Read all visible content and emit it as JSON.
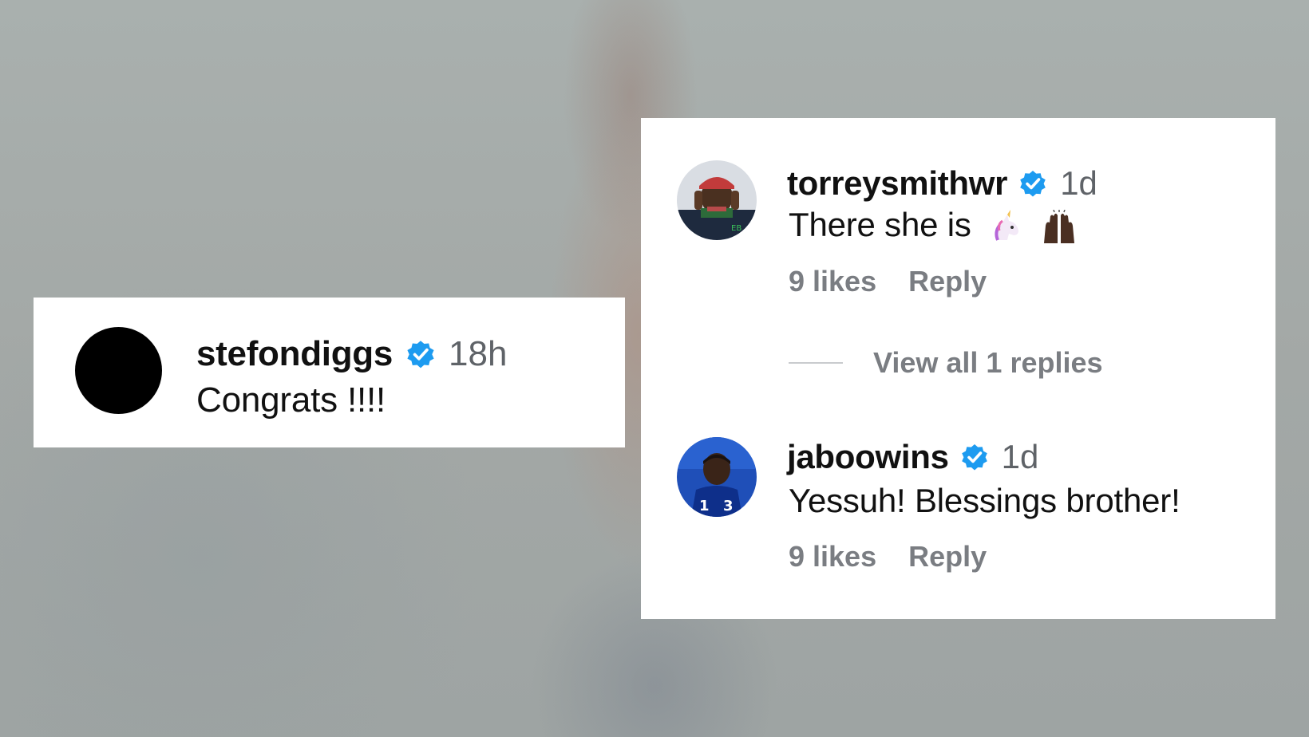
{
  "comments": {
    "stefondiggs": {
      "username": "stefondiggs",
      "time": "18h",
      "text": "Congrats !!!!",
      "verified_icon": "verified-badge-icon"
    },
    "torreysmithwr": {
      "username": "torreysmithwr",
      "time": "1d",
      "text": "There she is",
      "emojis": [
        "unicorn-icon",
        "raised-hands-icon"
      ],
      "likes": "9 likes",
      "reply": "Reply",
      "view_replies": "View all 1 replies"
    },
    "jaboowins": {
      "username": "jaboowins",
      "time": "1d",
      "text": "Yessuh! Blessings brother!",
      "likes": "9 likes",
      "reply": "Reply"
    }
  },
  "colors": {
    "verified": "#1d9bf0",
    "meta_text": "#7a7d82",
    "time_text": "#5f6368"
  }
}
